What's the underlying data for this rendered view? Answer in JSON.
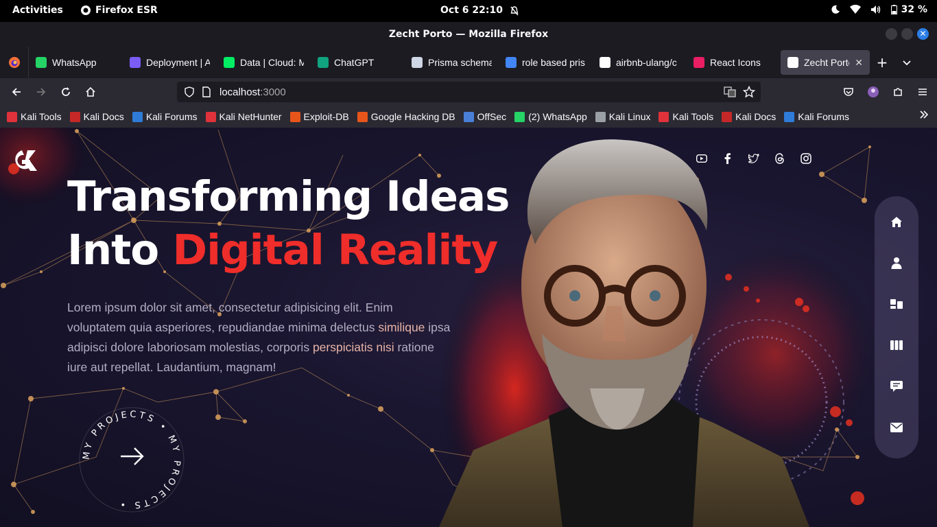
{
  "system_bar": {
    "activities": "Activities",
    "app_name": "Firefox ESR",
    "clock": "Oct 6  22:10",
    "battery": "32 %"
  },
  "window": {
    "title": "Zecht Porto — Mozilla Firefox"
  },
  "tabs": [
    {
      "label": "WhatsApp",
      "icon": "whatsapp-icon",
      "color": "#25d366"
    },
    {
      "label": "Deployment | A",
      "icon": "shield-icon",
      "color": "#7b5cf5"
    },
    {
      "label": "Data | Cloud: M",
      "icon": "leaf-icon",
      "color": "#00ed64"
    },
    {
      "label": "ChatGPT",
      "icon": "chatgpt-icon",
      "color": "#10a37f"
    },
    {
      "label": "Prisma schema",
      "icon": "prisma-icon",
      "color": "#cfd6e6"
    },
    {
      "label": "role based pris",
      "icon": "google-icon",
      "color": "#4285f4"
    },
    {
      "label": "airbnb-ulang/c",
      "icon": "github-icon",
      "color": "#ffffff"
    },
    {
      "label": "React Icons",
      "icon": "react-icon",
      "color": "#e91e63"
    },
    {
      "label": "Zecht Porto",
      "icon": "g-logo-icon",
      "color": "#ffffff",
      "active": true
    }
  ],
  "navbar": {
    "url_host": "localhost",
    "url_port": ":3000"
  },
  "bookmarks": [
    {
      "label": "Kali Tools",
      "color": "#e0323a"
    },
    {
      "label": "Kali Docs",
      "color": "#c62828"
    },
    {
      "label": "Kali Forums",
      "color": "#2f7bd8"
    },
    {
      "label": "Kali NetHunter",
      "color": "#e0323a"
    },
    {
      "label": "Exploit-DB",
      "color": "#e8551a"
    },
    {
      "label": "Google Hacking DB",
      "color": "#e8551a"
    },
    {
      "label": "OffSec",
      "color": "#4a7fd8"
    },
    {
      "label": "(2) WhatsApp",
      "color": "#25d366"
    },
    {
      "label": "Kali Linux",
      "color": "#9aa0a6"
    },
    {
      "label": "Kali Tools",
      "color": "#e0323a"
    },
    {
      "label": "Kali Docs",
      "color": "#c62828"
    },
    {
      "label": "Kali Forums",
      "color": "#2f7bd8"
    }
  ],
  "hero": {
    "title_line1": "Transforming Ideas",
    "title_line2_prefix": "Into ",
    "title_line2_accent": "Digital Reality",
    "body_part1": "Lorem ipsum dolor sit amet, consectetur adipisicing elit. Enim voluptatem quia asperiores, repudiandae minima delectus ",
    "body_hl1": "similique",
    "body_part2": " ipsa adipisci dolore laboriosam molestias, corporis ",
    "body_hl2": "perspiciatis nisi",
    "body_part3": " ratione iure aut repellat. Laudantium, magnam!",
    "badge_text": "MY PROJECTS • MY PROJECTS •",
    "accent_color": "#ef2d2a"
  },
  "social": [
    "youtube-icon",
    "facebook-icon",
    "twitter-icon",
    "threads-icon",
    "instagram-icon"
  ],
  "side_nav": [
    "home-icon",
    "user-icon",
    "services-icon",
    "portfolio-icon",
    "testimonials-icon",
    "mail-icon"
  ]
}
